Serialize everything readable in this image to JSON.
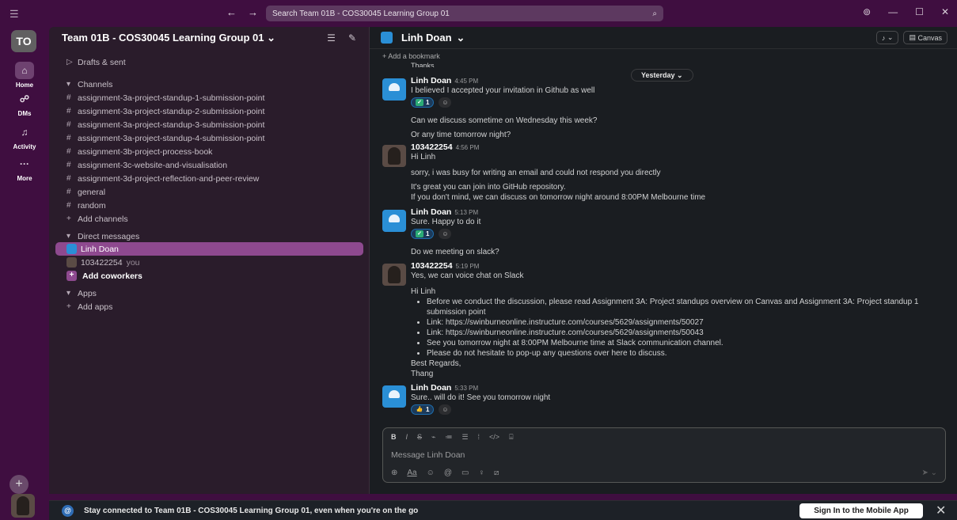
{
  "titlebar": {
    "menu_icon": "hamburger-icon",
    "search_placeholder": "Search Team 01B - COS30045 Learning Group 01"
  },
  "rail": {
    "workspace_badge": "TO",
    "items": [
      {
        "label": "Home",
        "icon": "home-icon",
        "glyph": "⌂"
      },
      {
        "label": "DMs",
        "icon": "dm-icon",
        "glyph": "☍"
      },
      {
        "label": "Activity",
        "icon": "bell-icon",
        "glyph": "🔔"
      },
      {
        "label": "More",
        "icon": "more-icon",
        "glyph": "···"
      }
    ]
  },
  "sidebar": {
    "workspace_title": "Team 01B - COS30045 Learning Group 01",
    "drafts": "Drafts & sent",
    "channels_header": "Channels",
    "channels": [
      "assignment-3a-project-standup-1-submission-point",
      "assignment-3a-project-standup-2-submission-point",
      "assignment-3a-project-standup-3-submission-point",
      "assignment-3a-project-standup-4-submission-point",
      "assignment-3b-project-process-book",
      "assignment-3c-website-and-visualisation",
      "assignment-3d-project-reflection-and-peer-review",
      "general",
      "random"
    ],
    "add_channels": "Add channels",
    "dm_header": "Direct messages",
    "dms": [
      {
        "name": "Linh Doan",
        "active": true
      },
      {
        "name": "103422254",
        "suffix": "you"
      }
    ],
    "add_coworkers": "Add coworkers",
    "apps_header": "Apps",
    "add_apps": "Add apps"
  },
  "main": {
    "conversation_title": "Linh Doan",
    "canvas_label": "Canvas",
    "bookmark": "+ Add a bookmark",
    "thanks": "Thanks",
    "day_pill": "Yesterday",
    "messages": [
      {
        "author": "Linh Doan",
        "time": "4:45 PM",
        "lines": [
          "I believed I accepted your invitation in Github as well"
        ],
        "reaction": {
          "emoji": "check-emoji",
          "count": "1"
        }
      },
      {
        "author": "",
        "time": "",
        "lines": [
          "Can we discuss sometime on Wednesday this week?"
        ]
      },
      {
        "author": "",
        "time": "",
        "lines": [
          "Or any time tomorrow night?"
        ]
      },
      {
        "author": "103422254",
        "time": "4:56 PM",
        "lines": [
          "Hi Linh"
        ]
      },
      {
        "author": "",
        "time": "",
        "lines": [
          "sorry, i was busy for writing an email and could not respond you directly"
        ]
      },
      {
        "author": "",
        "time": "",
        "lines": [
          "It's great you can join into GitHub repository.",
          "If you don't mind, we can discuss on tomorrow night around 8:00PM Melbourne time"
        ]
      },
      {
        "author": "Linh Doan",
        "time": "5:13 PM",
        "lines": [
          "Sure. Happy to do it"
        ],
        "reaction": {
          "emoji": "check-emoji",
          "count": "1"
        }
      },
      {
        "author": "",
        "time": "",
        "lines": [
          "Do we meeting on slack?"
        ]
      },
      {
        "author": "103422254",
        "time": "5:19 PM",
        "lines": [
          "Yes, we can voice chat on Slack"
        ]
      },
      {
        "author": "",
        "time": "",
        "lines": [
          "Hi Linh"
        ],
        "bullets": [
          "Before we conduct the discussion, please read Assignment 3A: Project standups overview on Canvas and Assignment 3A: Project standup 1 submission point",
          {
            "label": "Link: ",
            "url": "https://swinburneonline.instructure.com/courses/5629/assignments/50027"
          },
          {
            "label": "Link: ",
            "url": "https://swinburneonline.instructure.com/courses/5629/assignments/50043"
          },
          "See you tomorrow night at 8:00PM Melbourne time at Slack communication channel.",
          "Please do not hesitate to pop-up any questions over here to discuss."
        ],
        "closing": [
          "Best Regards,",
          "Thang"
        ]
      },
      {
        "author": "Linh Doan",
        "time": "5:33 PM",
        "lines": [
          "Sure.. will do it! See you tomorrow night"
        ],
        "reaction": {
          "emoji": "thumbs-up-emoji",
          "count": "1"
        }
      }
    ],
    "composer_placeholder": "Message Linh Doan"
  },
  "banner": {
    "message": "Stay connected to Team 01B - COS30045 Learning Group 01, even when you're on the go",
    "button": "Sign In to the Mobile App"
  },
  "colors": {
    "aubergine": "#3f0e40",
    "sidebar": "#2a1c2b",
    "active_item": "#8e498f",
    "link": "#1d9bd1",
    "main_bg": "#1a1d21"
  }
}
